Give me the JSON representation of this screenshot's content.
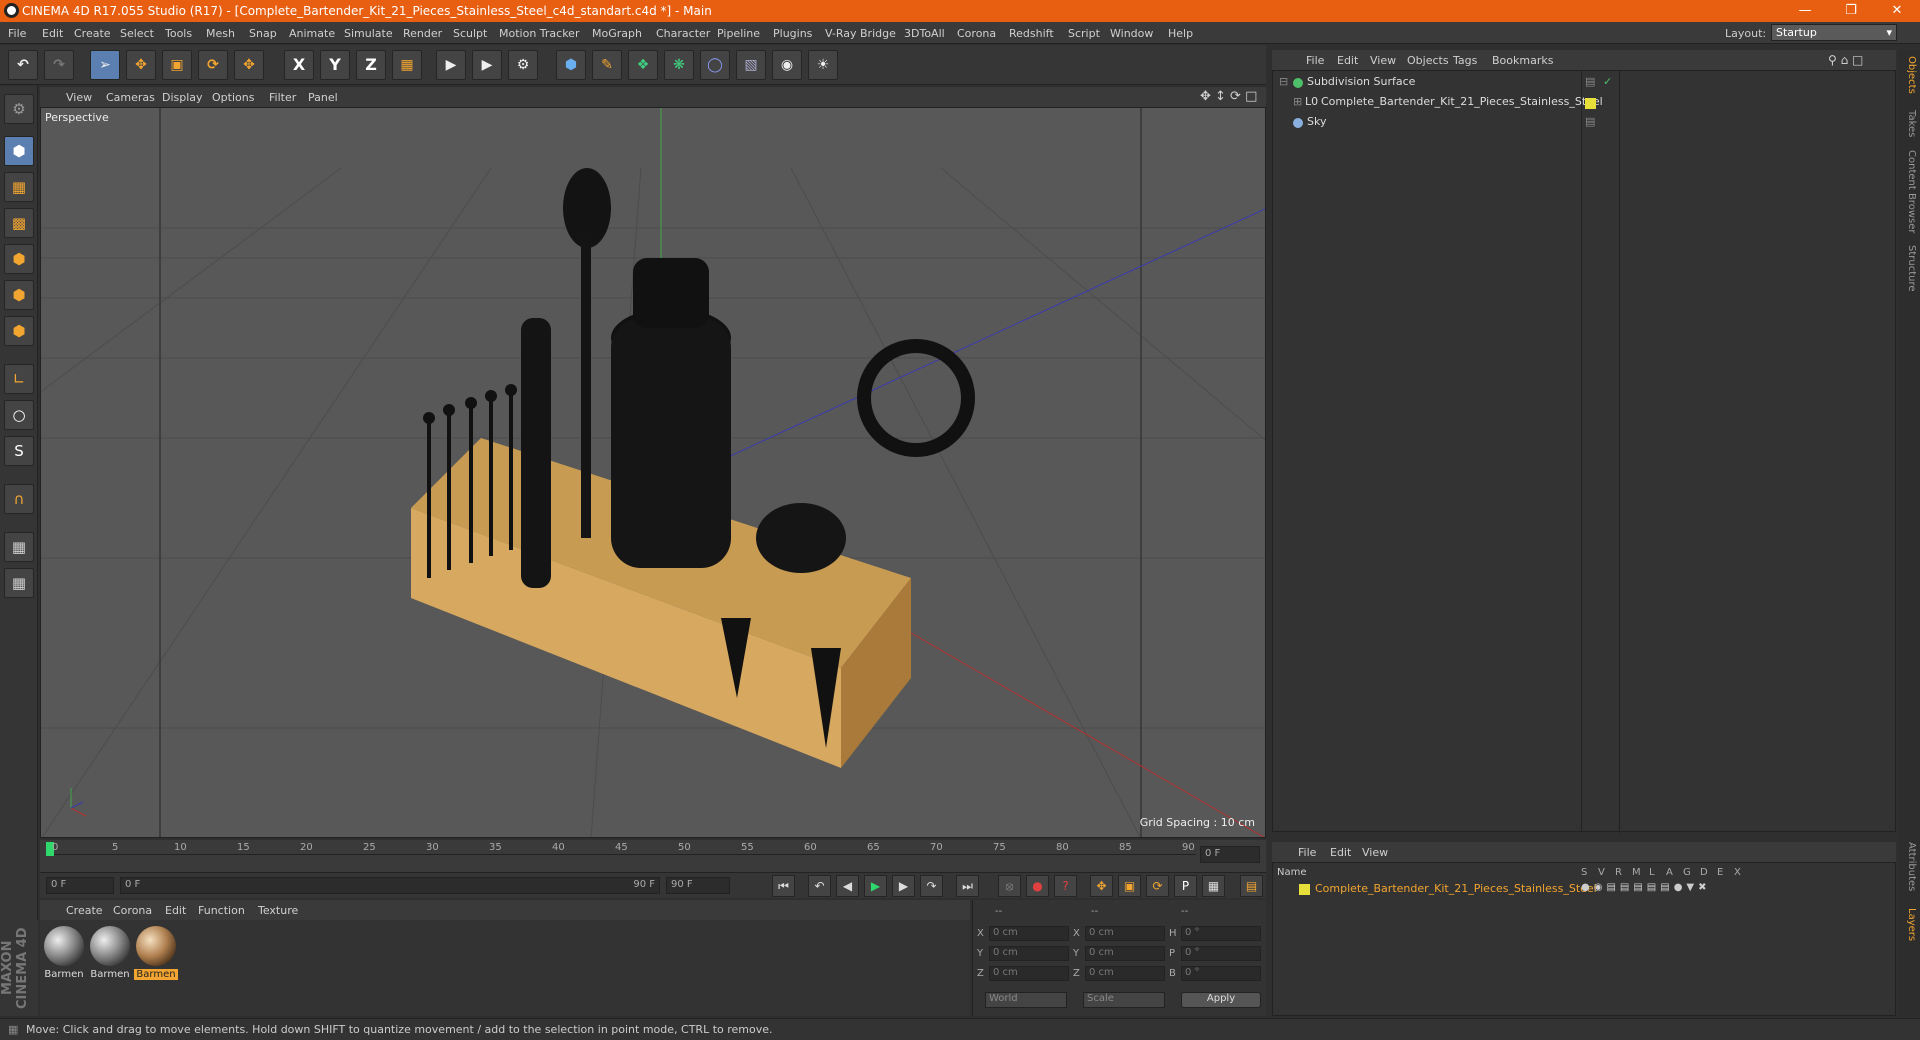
{
  "title": "CINEMA 4D R17.055 Studio (R17) - [Complete_Bartender_Kit_21_Pieces_Stainless_Steel_c4d_standart.c4d *] - Main",
  "menu": [
    "File",
    "Edit",
    "Create",
    "Select",
    "Tools",
    "Mesh",
    "Snap",
    "Animate",
    "Simulate",
    "Render",
    "Sculpt",
    "Motion Tracker",
    "MoGraph",
    "Character",
    "Pipeline",
    "Plugins",
    "V-Ray Bridge",
    "3DToAll",
    "Corona",
    "Redshift",
    "Script",
    "Window",
    "Help"
  ],
  "layout": {
    "label": "Layout:",
    "value": "Startup"
  },
  "toolbar": {
    "x": "X",
    "y": "Y",
    "z": "Z"
  },
  "viewport": {
    "menu": [
      "View",
      "Cameras",
      "Display",
      "Options",
      "Filter",
      "Panel"
    ],
    "label": "Perspective",
    "grid_spacing": "Grid Spacing : 10 cm"
  },
  "timeline": {
    "ticks": [
      "0",
      "5",
      "10",
      "15",
      "20",
      "25",
      "30",
      "35",
      "40",
      "45",
      "50",
      "55",
      "60",
      "65",
      "70",
      "75",
      "80",
      "85",
      "90"
    ],
    "frame": "0 F",
    "start": "0 F",
    "range_start": "0 F",
    "range_end": "90 F",
    "end": "90 F"
  },
  "materials": {
    "menu": [
      "Create",
      "Corona",
      "Edit",
      "Function",
      "Texture"
    ],
    "items": [
      {
        "label": "Barmen",
        "style": "silver"
      },
      {
        "label": "Barmen",
        "style": "silver"
      },
      {
        "label": "Barmen",
        "style": "gold",
        "selected": true
      }
    ]
  },
  "coords": {
    "headers": [
      "--",
      "--",
      "--"
    ],
    "rows": [
      {
        "a": "X",
        "av": "0 cm",
        "b": "X",
        "bv": "0 cm",
        "c": "H",
        "cv": "0 °"
      },
      {
        "a": "Y",
        "av": "0 cm",
        "b": "Y",
        "bv": "0 cm",
        "c": "P",
        "cv": "0 °"
      },
      {
        "a": "Z",
        "av": "0 cm",
        "b": "Z",
        "bv": "0 cm",
        "c": "B",
        "cv": "0 °"
      }
    ],
    "mode1": "World",
    "mode2": "Scale",
    "apply": "Apply"
  },
  "objects": {
    "menu": [
      "File",
      "Edit",
      "View",
      "Objects",
      "Tags",
      "Bookmarks"
    ],
    "items": [
      {
        "name": "Subdivision Surface",
        "icon": "subdivision-icon",
        "color": "#4fc06a"
      },
      {
        "name": "Complete_Bartender_Kit_21_Pieces_Stainless_Steel",
        "icon": "null-icon",
        "color": "#e8e03a"
      },
      {
        "name": "Sky",
        "icon": "sky-icon",
        "color": "#8ab0e0"
      }
    ]
  },
  "layers": {
    "menu": [
      "File",
      "Edit",
      "View"
    ],
    "header_name": "Name",
    "columns": [
      "S",
      "V",
      "R",
      "M",
      "L",
      "A",
      "G",
      "D",
      "E",
      "X"
    ],
    "item": "Complete_Bartender_Kit_21_Pieces_Stainless_Steel"
  },
  "sidetabs": [
    "Objects",
    "Takes",
    "Content Browser",
    "Structure",
    "Attributes",
    "Layers"
  ],
  "brand": "MAXON CINEMA 4D",
  "status": "Move: Click and drag to move elements. Hold down SHIFT to quantize movement / add to the selection in point mode, CTRL to remove."
}
